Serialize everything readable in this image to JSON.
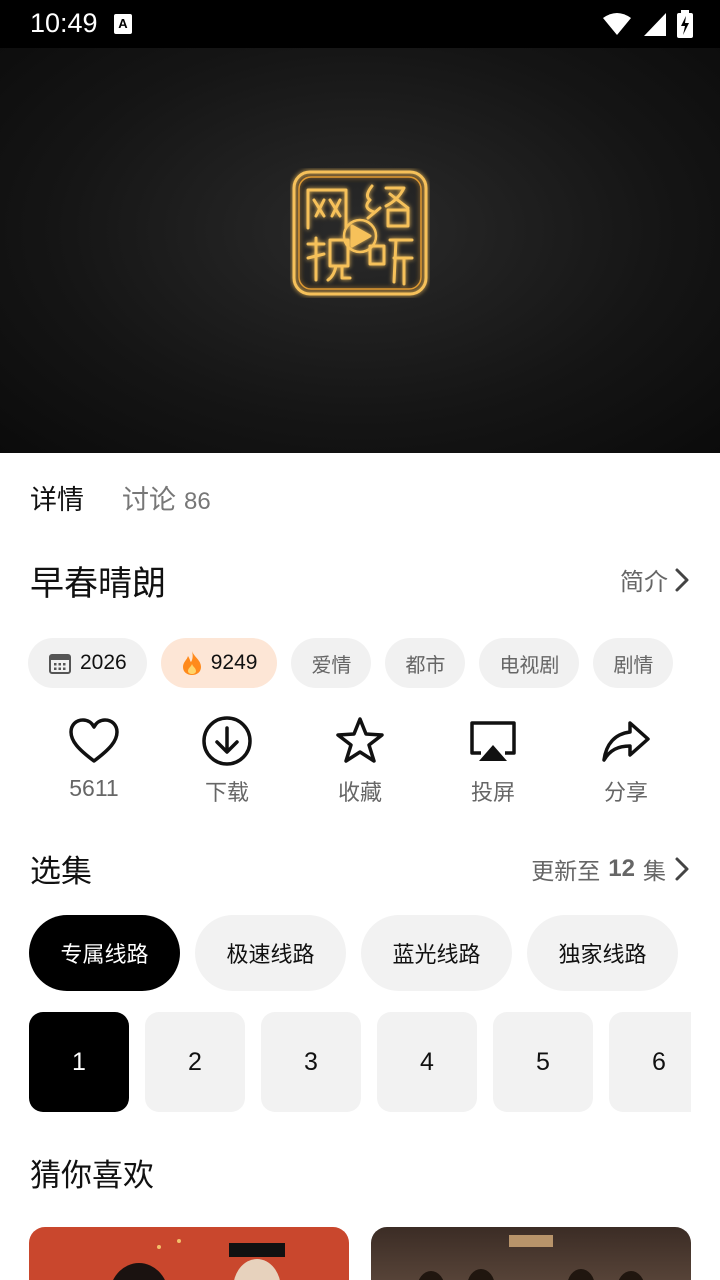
{
  "status_bar": {
    "time": "10:49",
    "notification": "A"
  },
  "tabs": [
    {
      "label": "详情"
    },
    {
      "label": "讨论",
      "count": "86"
    }
  ],
  "show": {
    "title": "早春晴朗",
    "intro_label": "简介",
    "tags": {
      "year": "2026",
      "heat": "9249",
      "genres": [
        "爱情",
        "都市",
        "电视剧",
        "剧情"
      ]
    }
  },
  "actions": {
    "like_count": "5611",
    "download": "下载",
    "favorite": "收藏",
    "cast": "投屏",
    "share": "分享"
  },
  "episodes_section": {
    "title": "选集",
    "update_prefix": "更新至",
    "update_count": "12",
    "update_suffix": "集",
    "routes": [
      "专属线路",
      "极速线路",
      "蓝光线路",
      "独家线路"
    ],
    "episodes": [
      "1",
      "2",
      "3",
      "4",
      "5",
      "6"
    ]
  },
  "recommend": {
    "title": "猜你喜欢"
  },
  "colors": {
    "accent_black": "#000000",
    "hot_bg": "#fde6d6",
    "chip_bg": "#f1f1f1",
    "logo_gold": "#f0b040"
  }
}
